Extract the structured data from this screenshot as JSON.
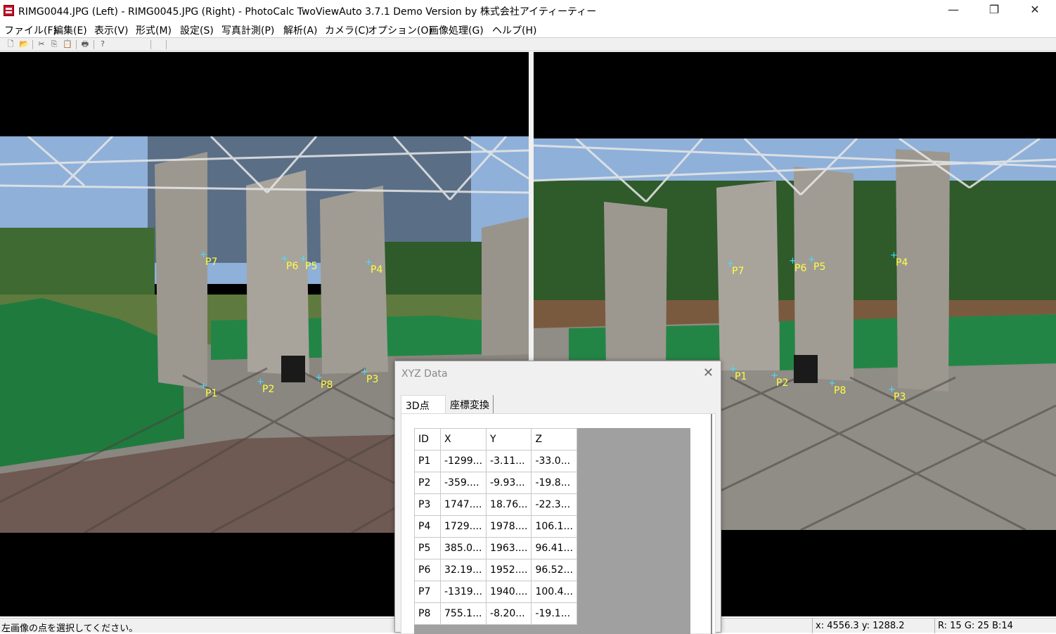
{
  "window": {
    "title": "RIMG0044.JPG (Left) - RIMG0045.JPG (Right) - PhotoCalc TwoViewAuto 3.7.1 Demo Version by 株式会社アイティーティー",
    "minimize": "—",
    "maximize": "❐",
    "close": "✕"
  },
  "menu": [
    "ファイル(F)",
    "編集(E)",
    "表示(V)",
    "形式(M)",
    "設定(S)",
    "写真計測(P)",
    "解析(A)",
    "カメラ(C)",
    "オプション(O)",
    "画像処理(G)",
    "ヘルプ(H)"
  ],
  "toolbar_icons": [
    "new-icon",
    "open-icon",
    "cut-icon",
    "copy-icon",
    "paste-icon",
    "print-icon",
    "help-icon"
  ],
  "toolbar_glyphs": [
    "🗋",
    "📂",
    "✂",
    "⎘",
    "📋",
    "🖶",
    "?"
  ],
  "left_points": [
    "P7",
    "P6",
    "P5",
    "P4",
    "P1",
    "P2",
    "P8",
    "P3"
  ],
  "right_points": [
    "P7",
    "P6",
    "P5",
    "P4",
    "P1",
    "P2",
    "P8",
    "P3"
  ],
  "dialog": {
    "title": "XYZ Data",
    "close": "✕",
    "tabs": [
      "3D点",
      "座標変換"
    ],
    "columns": [
      "ID",
      "X",
      "Y",
      "Z"
    ],
    "rows": [
      [
        "P1",
        "-1299...",
        "-3.11...",
        "-33.0..."
      ],
      [
        "P2",
        "-359....",
        "-9.93...",
        "-19.8..."
      ],
      [
        "P3",
        "1747....",
        "18.76...",
        "-22.3..."
      ],
      [
        "P4",
        "1729....",
        "1978....",
        "106.1..."
      ],
      [
        "P5",
        "385.0...",
        "1963....",
        "96.41..."
      ],
      [
        "P6",
        "32.19...",
        "1952....",
        "96.52..."
      ],
      [
        "P7",
        "-1319...",
        "1940....",
        "100.4..."
      ],
      [
        "P8",
        "755.1...",
        "-8.20...",
        "-19.1..."
      ]
    ]
  },
  "status": {
    "message": "左画像の点を選択してください。",
    "coords": "x: 4556.3 y: 1288.2",
    "rgb": "R: 15 G: 25  B:14"
  },
  "colors": {
    "point_label": "#ffff40",
    "point_marker": "#40e0ff",
    "net_green": "#1f7a3e",
    "app_icon": "#c8102e"
  }
}
